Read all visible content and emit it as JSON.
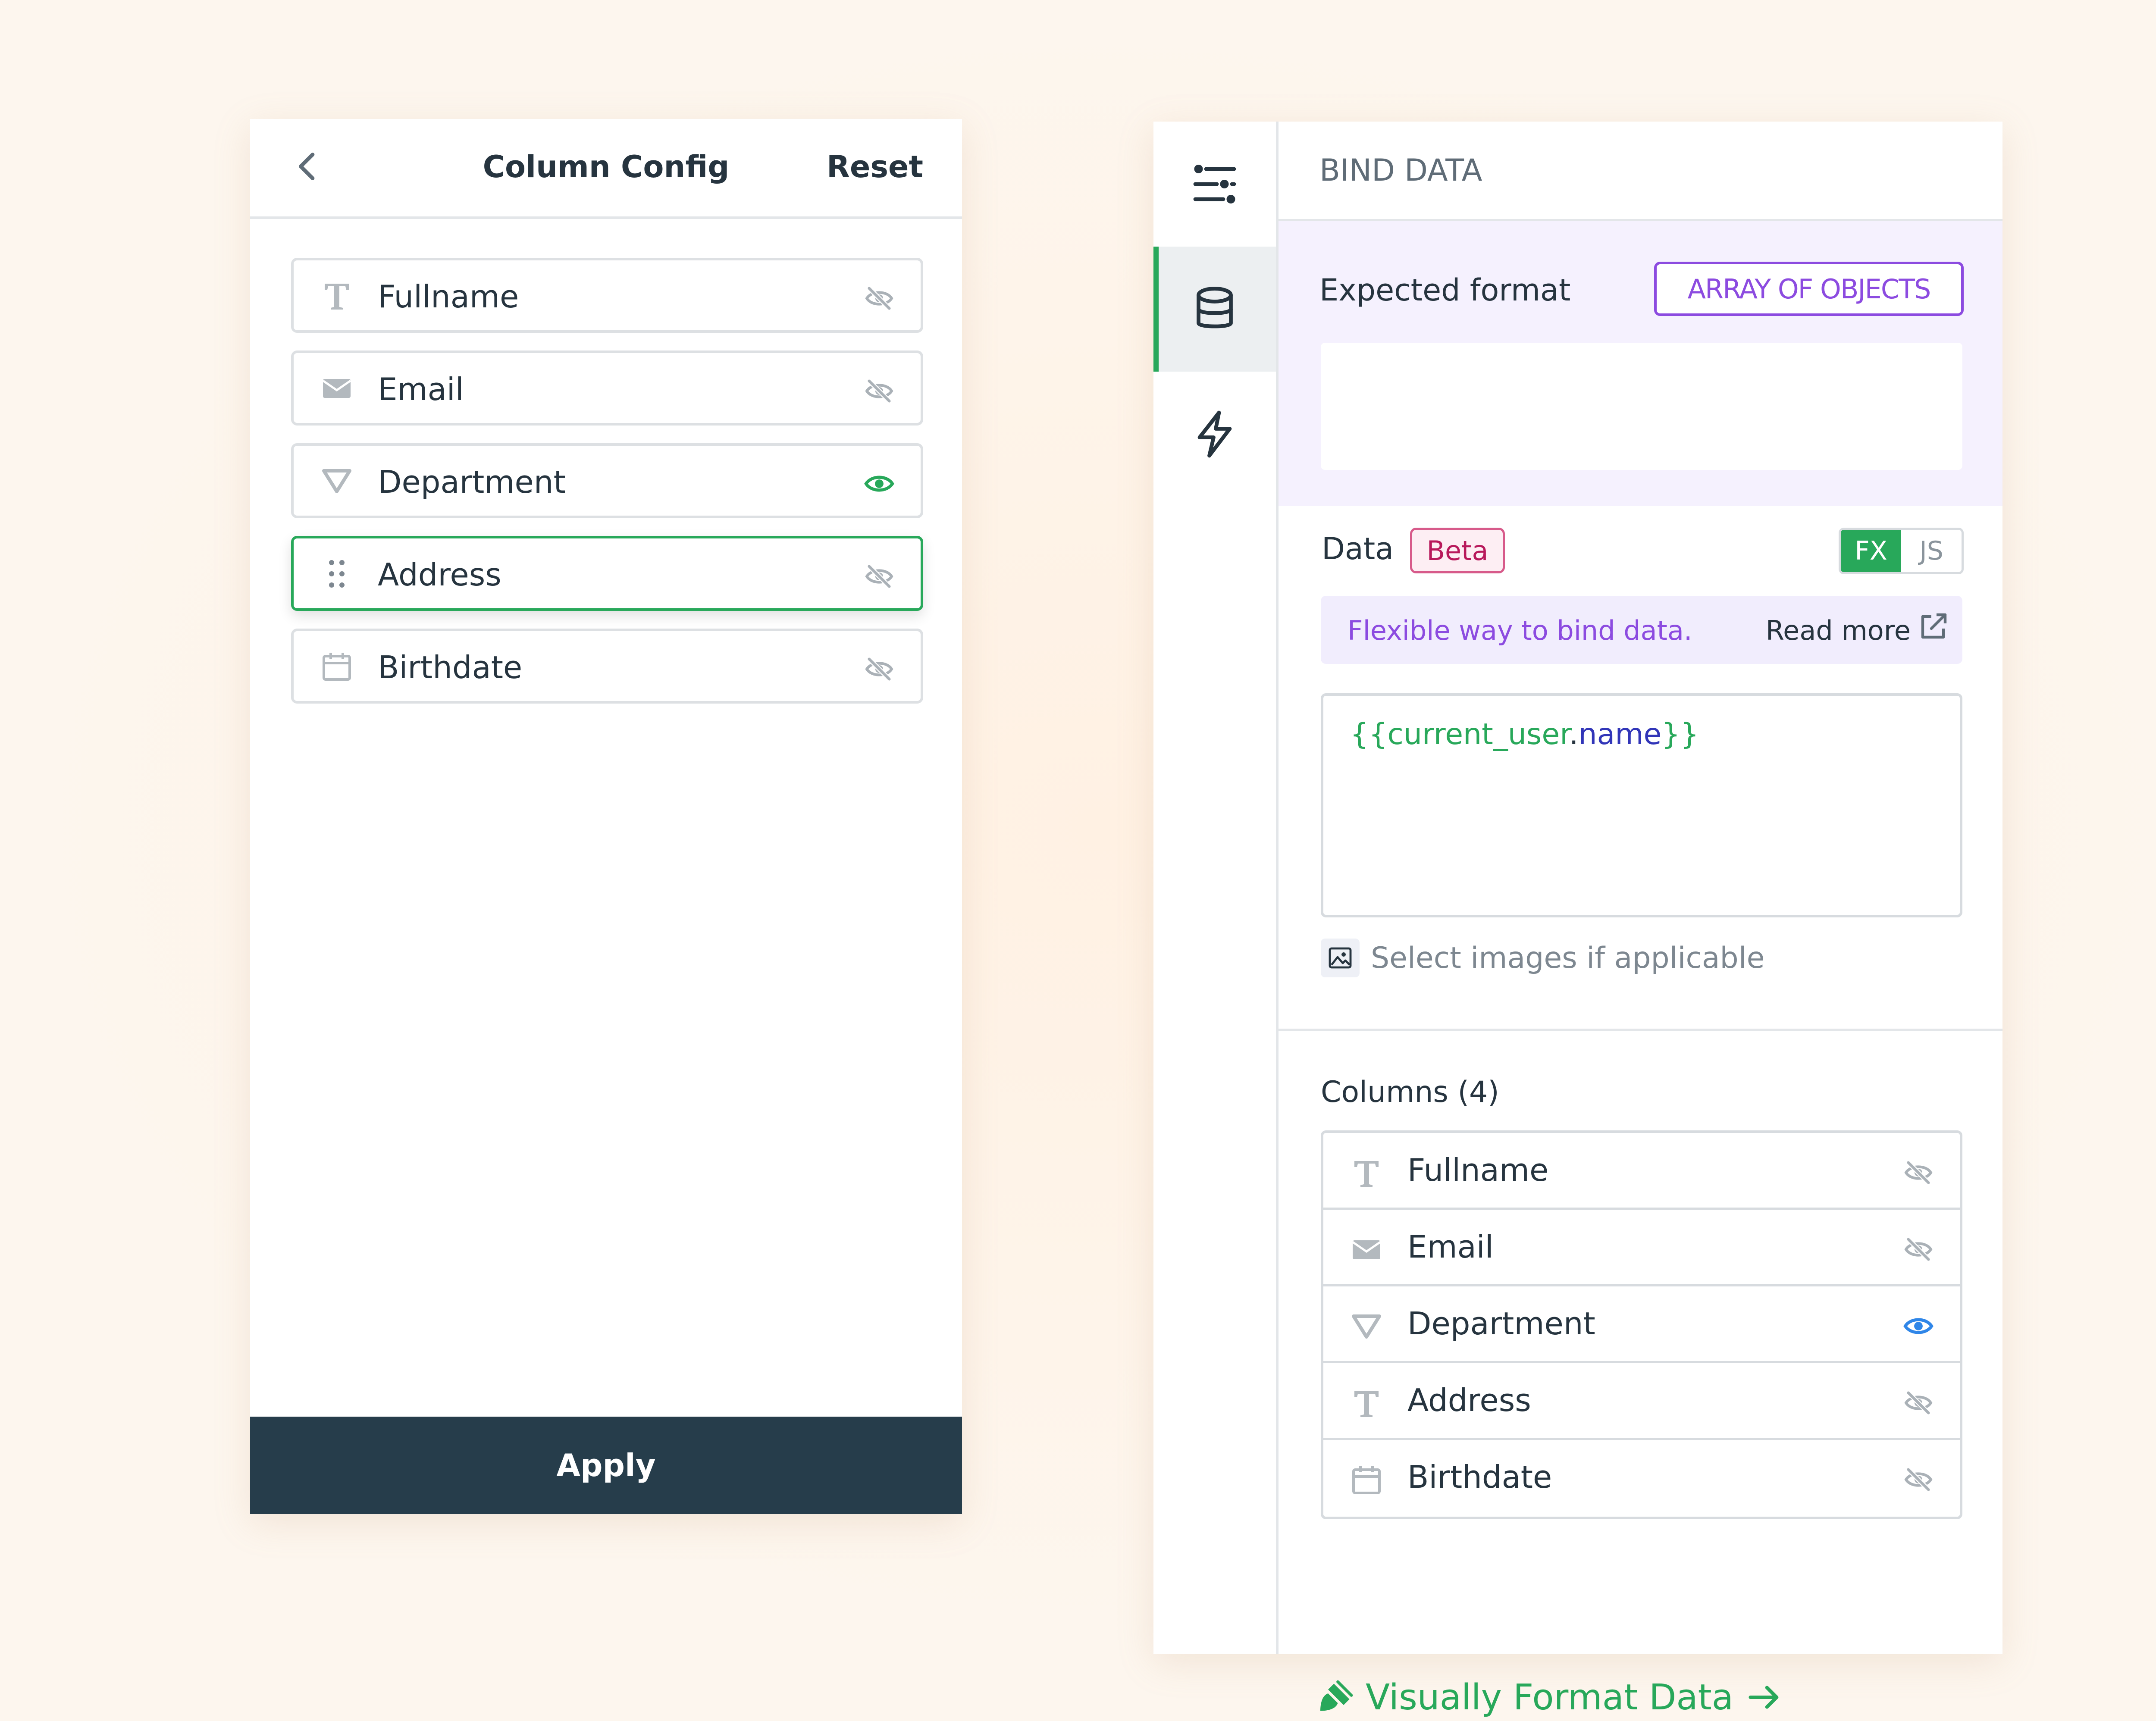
{
  "colors": {
    "accent": "#28a85a",
    "dark": "#263d4b",
    "purple": "#8c4be0",
    "beta_pink": "#b8195b",
    "visible_blue": "#2f86e8",
    "hidden_gray": "#aab1b7"
  },
  "column_config": {
    "title": "Column Config",
    "reset_label": "Reset",
    "back_icon": "chevron-left-icon",
    "apply_label": "Apply",
    "items": [
      {
        "label": "Fullname",
        "type_icon": "text-icon",
        "visible": false,
        "active": false
      },
      {
        "label": "Email",
        "type_icon": "email-icon",
        "visible": false,
        "active": false
      },
      {
        "label": "Department",
        "type_icon": "dropdown-triangle-icon",
        "visible": true,
        "active": false
      },
      {
        "label": "Address",
        "type_icon": "drag-handle-icon",
        "visible": false,
        "active": true
      },
      {
        "label": "Birthdate",
        "type_icon": "calendar-icon",
        "visible": false,
        "active": false
      }
    ]
  },
  "sidebar": {
    "items": [
      {
        "icon": "sliders-icon",
        "active": false
      },
      {
        "icon": "database-icon",
        "active": true
      },
      {
        "icon": "lightning-icon",
        "active": false
      }
    ]
  },
  "bind_data": {
    "header_title": "BIND DATA",
    "expected_format_label": "Expected format",
    "format_badge": "ARRAY OF OBJECTS",
    "data_label": "Data",
    "beta_label": "Beta",
    "mode_options": [
      "FX",
      "JS"
    ],
    "mode_selected": "FX",
    "info_text": "Flexible way to bind data.",
    "read_more_label": "Read more",
    "code": {
      "open": "{{",
      "var": "current_user",
      "dot": ".",
      "prop": "name",
      "close": "}}"
    },
    "select_images_label": "Select images if applicable",
    "columns_label": "Columns (4)",
    "columns": [
      {
        "label": "Fullname",
        "type_icon": "text-icon",
        "visible": false
      },
      {
        "label": "Email",
        "type_icon": "email-icon",
        "visible": false
      },
      {
        "label": "Department",
        "type_icon": "dropdown-triangle-icon",
        "visible": true
      },
      {
        "label": "Address",
        "type_icon": "text-icon",
        "visible": false
      },
      {
        "label": "Birthdate",
        "type_icon": "calendar-icon",
        "visible": false
      }
    ],
    "visual_format_label": "Visually Format Data"
  }
}
